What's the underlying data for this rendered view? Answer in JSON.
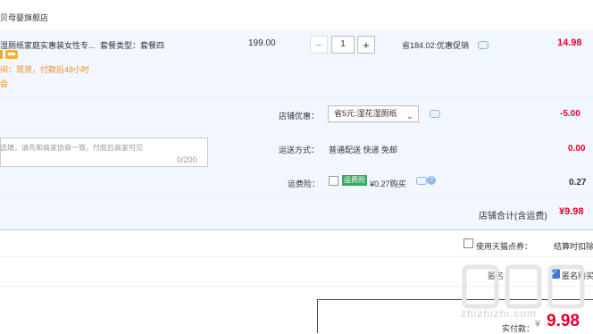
{
  "store": {
    "name": "贝母婴旗舰店"
  },
  "item": {
    "title": "湿厕纸家庭实惠装女性专...",
    "package": "套餐类型：套餐四",
    "ship_time": "间：现货，付款后48小时",
    "extra_mark": "会",
    "unit_price": "199.00",
    "qty_minus": "−",
    "quantity": "1",
    "qty_plus": "+",
    "discount": "省184.02:优惠促销",
    "line_total": "14.98"
  },
  "note": {
    "placeholder": "选填，请先和商家协商一致，付款后商家可见",
    "count": "0/200"
  },
  "shop_discount": {
    "label": "店铺优惠：",
    "selected": "省5元:湿花湿厕纸",
    "amount": "-5.00"
  },
  "shipping": {
    "label": "运送方式：",
    "value": "普通配送 快递 免邮",
    "amount": "0.00"
  },
  "insurance": {
    "label": "运费险：",
    "tag": "运费险",
    "price": "¥0.27购买",
    "amount": "0.27",
    "help_icon": "?"
  },
  "store_total": {
    "label": "店铺合计(含运费)",
    "amount": "¥9.98"
  },
  "points": {
    "label": "使用天猫点券：",
    "deduct": "结算时扣除"
  },
  "anonymous": {
    "label": "匿名：",
    "text": "匿名购买"
  },
  "pay": {
    "label": "实付款：",
    "symbol": "¥",
    "amount": "9.98"
  },
  "watermark": {
    "text": "zhizhizhi.com"
  },
  "colors": {
    "accent": "#e4002b",
    "row_bg": "#f2f7ff",
    "warning": "#f08a24",
    "check": "#3c7ad9"
  },
  "icons": {
    "chat": "chat-bubble-icon",
    "dropdown": "chevron-down-icon",
    "check": "checkmark-icon"
  }
}
